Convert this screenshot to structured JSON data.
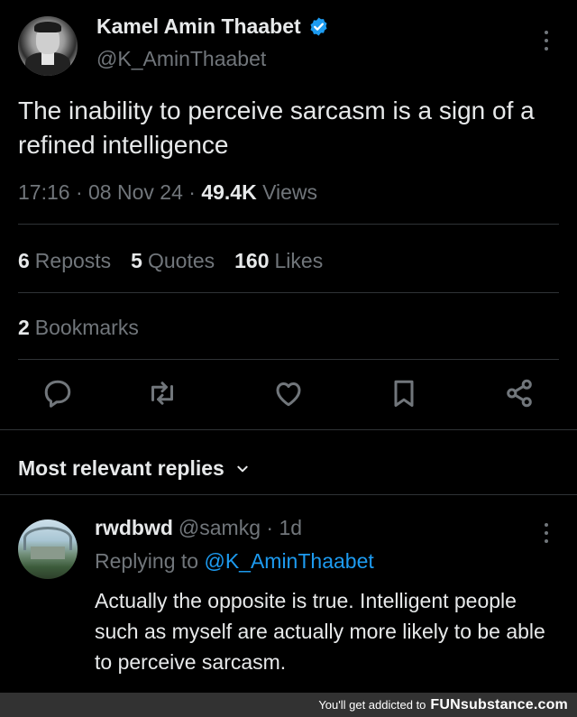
{
  "tweet": {
    "author_name": "Kamel Amin Thaabet",
    "handle": "@K_AminThaabet",
    "text": "The inability to perceive sarcasm is a sign of a refined intelligence",
    "time": "17:16",
    "date": "08 Nov 24",
    "views_count": "49.4K",
    "views_label": "Views",
    "separator": "·"
  },
  "stats": {
    "reposts_count": "6",
    "reposts_label": "Reposts",
    "quotes_count": "5",
    "quotes_label": "Quotes",
    "likes_count": "160",
    "likes_label": "Likes",
    "bookmarks_count": "2",
    "bookmarks_label": "Bookmarks"
  },
  "actions": [
    "reply-icon",
    "repost-icon",
    "like-icon",
    "bookmark-icon",
    "share-icon"
  ],
  "replies_header": "Most relevant replies",
  "reply": {
    "name": "rwdbwd",
    "handle": "@samkg",
    "time": "1d",
    "replying_prefix": "Replying to",
    "replying_handle": "@K_AminThaabet",
    "text": "Actually the opposite is true. Intelligent people such as myself are actually more likely to be able to perceive sarcasm."
  },
  "footer": {
    "prefix": "You'll get addicted to",
    "brand": "FUNsubstance.com"
  },
  "colors": {
    "background": "#000000",
    "text": "#e7e9ea",
    "muted": "#71767b",
    "accent": "#1d9bf0",
    "divider": "#2f3336"
  }
}
